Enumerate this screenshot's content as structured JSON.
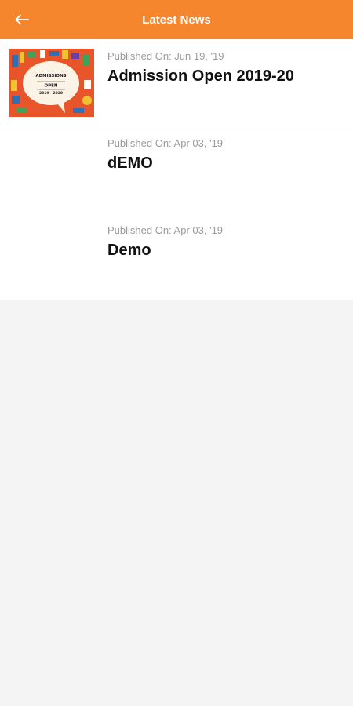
{
  "header": {
    "title": "Latest News",
    "back_icon": "arrow-left-icon",
    "bg_color": "#f5862d"
  },
  "news": [
    {
      "published": "Published On: Jun 19, '19",
      "title": "Admission Open 2019-20",
      "thumbnail": {
        "line1": "ADMISSIONS",
        "line2": "OPEN",
        "line3": "2019 - 2020"
      }
    },
    {
      "published": "Published On: Apr 03, '19",
      "title": "dEMO"
    },
    {
      "published": "Published On: Apr 03, '19",
      "title": "Demo"
    }
  ]
}
